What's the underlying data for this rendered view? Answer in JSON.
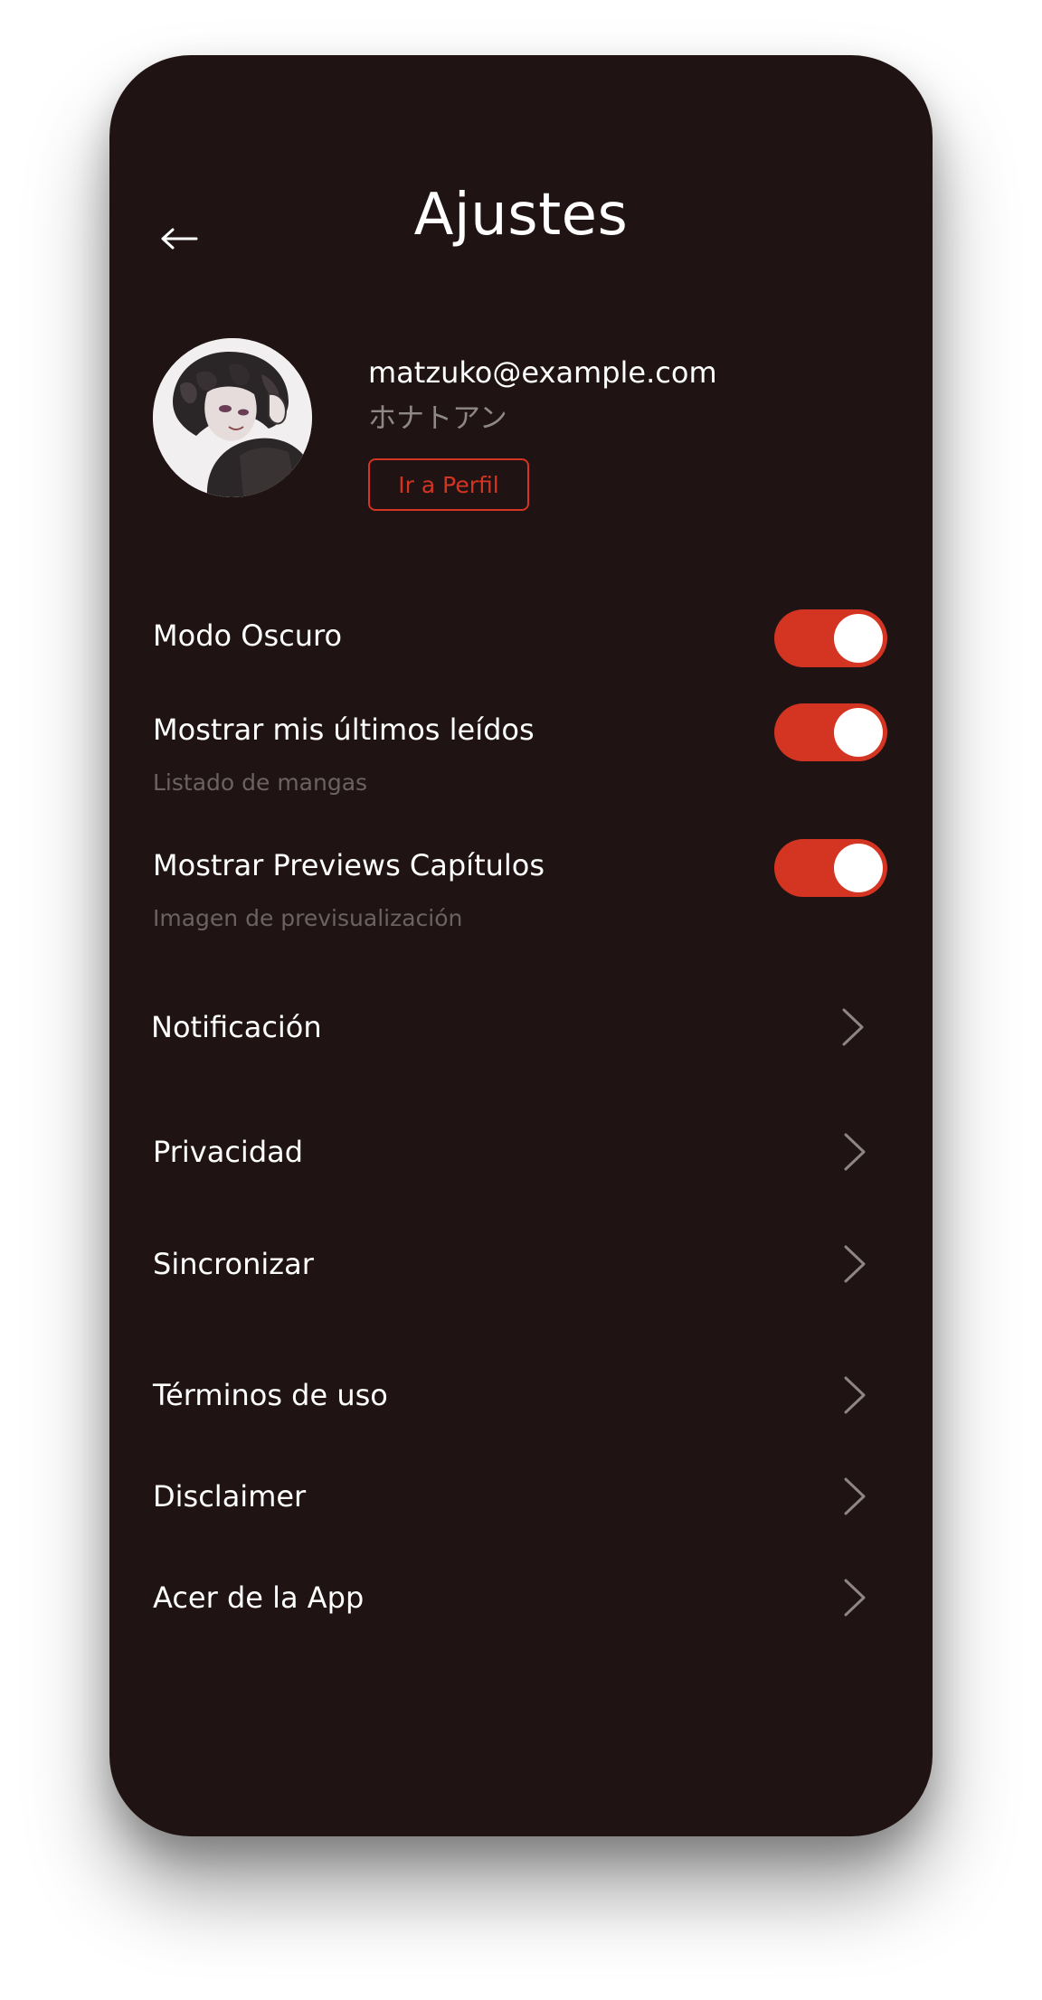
{
  "header": {
    "title": "Ajustes"
  },
  "profile": {
    "email": "matzuko@example.com",
    "username": "ホナトアン",
    "profile_button_label": "Ir a Perfil"
  },
  "toggles": [
    {
      "label": "Modo Oscuro",
      "sublabel": "",
      "on": true
    },
    {
      "label": "Mostrar mis últimos leídos",
      "sublabel": "Listado de mangas",
      "on": true
    },
    {
      "label": "Mostrar Previews Capítulos",
      "sublabel": "Imagen de previsualización",
      "on": true
    }
  ],
  "menu": [
    {
      "label": "Notificación"
    },
    {
      "label": "Privacidad"
    },
    {
      "label": "Sincronizar"
    },
    {
      "label": "Términos de uso"
    },
    {
      "label": "Disclaimer"
    },
    {
      "label": "Acer de la App"
    }
  ],
  "colors": {
    "background": "#201313",
    "accent": "#d43522",
    "text_primary": "#ffffff",
    "text_secondary": "#8f8889",
    "text_muted": "#6b6264"
  },
  "icons": {
    "back": "arrow-left-icon",
    "chevron": "chevron-right-icon"
  }
}
